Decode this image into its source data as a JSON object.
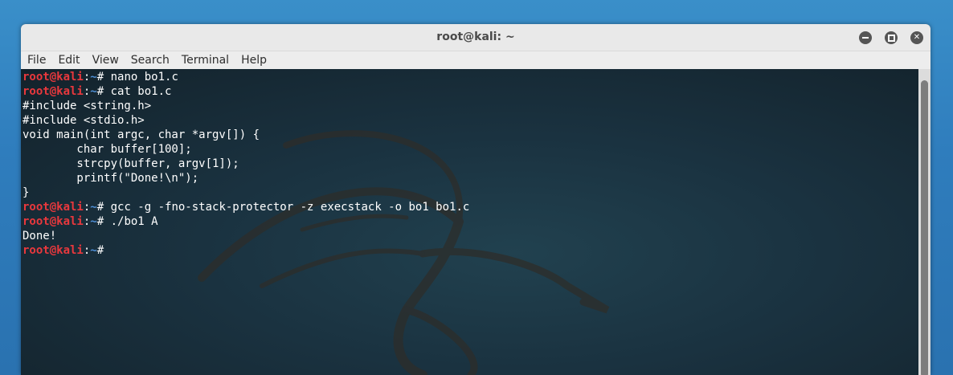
{
  "window": {
    "title": "root@kali: ~"
  },
  "menu": [
    "File",
    "Edit",
    "View",
    "Search",
    "Terminal",
    "Help"
  ],
  "prompt": {
    "user": "root@kali",
    "sep": ":",
    "path": "~",
    "symbol": "# "
  },
  "lines": [
    {
      "type": "cmd",
      "text": "nano bo1.c"
    },
    {
      "type": "cmd",
      "text": "cat bo1.c"
    },
    {
      "type": "out",
      "text": "#include <string.h>"
    },
    {
      "type": "out",
      "text": "#include <stdio.h>"
    },
    {
      "type": "out",
      "text": "void main(int argc, char *argv[]) {"
    },
    {
      "type": "out",
      "text": "        char buffer[100];"
    },
    {
      "type": "out",
      "text": "        strcpy(buffer, argv[1]);"
    },
    {
      "type": "out",
      "text": "        printf(\"Done!\\n\");"
    },
    {
      "type": "out",
      "text": "}"
    },
    {
      "type": "cmd",
      "text": "gcc -g -fno-stack-protector -z execstack -o bo1 bo1.c"
    },
    {
      "type": "cmd",
      "text": "./bo1 A"
    },
    {
      "type": "out",
      "text": "Done!"
    },
    {
      "type": "cmd",
      "text": ""
    }
  ],
  "colors": {
    "prompt_user": "#e8383d",
    "prompt_path": "#4f8fd6",
    "terminal_bg": "#1a3240",
    "text": "#ffffff"
  }
}
